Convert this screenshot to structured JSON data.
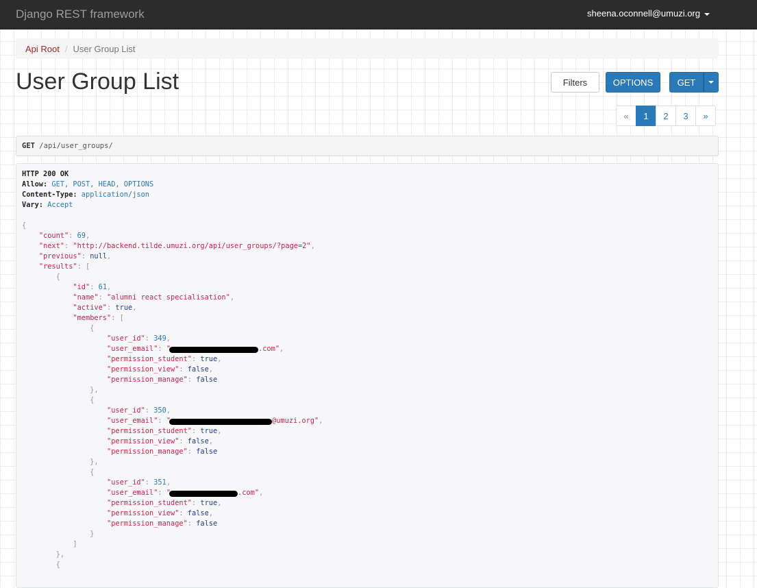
{
  "navbar": {
    "brand": "Django REST framework",
    "user": "sheena.oconnell@umuzi.org"
  },
  "breadcrumb": {
    "root": "Api Root",
    "current": "User Group List"
  },
  "page": {
    "title": "User Group List"
  },
  "buttons": {
    "filters": "Filters",
    "options": "OPTIONS",
    "get": "GET"
  },
  "pagination": {
    "prev": "«",
    "pages": [
      "1",
      "2",
      "3"
    ],
    "active": "1",
    "next": "»"
  },
  "request": {
    "method": "GET",
    "path": "/api/user_groups/"
  },
  "response": {
    "status": "HTTP 200 OK",
    "headers": {
      "allow_key": "Allow:",
      "allow_val": "GET, POST, HEAD, OPTIONS",
      "ctype_key": "Content-Type:",
      "ctype_val": "application/json",
      "vary_key": "Vary:",
      "vary_val": "Accept"
    },
    "body": {
      "count_key": "\"count\"",
      "count_val": "69",
      "next_key": "\"next\"",
      "next_val": "\"http://backend.tilde.umuzi.org/api/user_groups/?page=2\"",
      "previous_key": "\"previous\"",
      "previous_val": "null",
      "results_key": "\"results\"",
      "group": {
        "id_key": "\"id\"",
        "id_val": "61",
        "name_key": "\"name\"",
        "name_val": "\"alumni react specialisation\"",
        "active_key": "\"active\"",
        "active_val": "true",
        "members_key": "\"members\""
      },
      "members": [
        {
          "user_id": "349",
          "email_start": "\"",
          "email_end": ".com\"",
          "student": "true",
          "view": "false",
          "manage": "false"
        },
        {
          "user_id": "350",
          "email_start": "\"",
          "email_end": "@umuzi.org\"",
          "student": "true",
          "view": "false",
          "manage": "false"
        },
        {
          "user_id": "351",
          "email_start": "\"",
          "email_end": ".com\"",
          "student": "true",
          "view": "false",
          "manage": "false"
        }
      ],
      "keys": {
        "user_id": "\"user_id\"",
        "user_email": "\"user_email\"",
        "student": "\"permission_student\"",
        "view": "\"permission_view\"",
        "manage": "\"permission_manage\""
      }
    }
  }
}
